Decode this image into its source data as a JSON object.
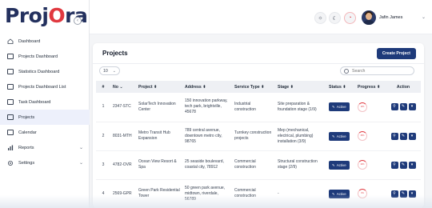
{
  "brand": {
    "logo_part1": "Proj",
    "logo_part2": "O",
    "logo_part3": "ra"
  },
  "sidebar": {
    "items": [
      {
        "label": "Dashboard",
        "icon": "home-icon"
      },
      {
        "label": "Projects Dashboard",
        "icon": "folder-icon"
      },
      {
        "label": "Statistics Dashboard",
        "icon": "chart-icon"
      },
      {
        "label": "Projects Dashboard List",
        "icon": "list-icon"
      },
      {
        "label": "Task Dashboard",
        "icon": "task-icon"
      },
      {
        "label": "Projects",
        "icon": "projects-icon",
        "active": true
      },
      {
        "label": "Calendar",
        "icon": "calendar-icon"
      },
      {
        "label": "Reports",
        "icon": "bar-chart-icon",
        "has_submenu": true
      },
      {
        "label": "Settings",
        "icon": "gear-icon",
        "has_submenu": true
      }
    ]
  },
  "topbar": {
    "collapse_icon": "chevron-left-icon",
    "icons": [
      "sun-icon",
      "moon-icon",
      "notification-icon"
    ],
    "user_name": "Jafin James",
    "user_chevron": "⌄"
  },
  "main": {
    "title": "Projects",
    "create_button": "Create Project",
    "page_length": "10",
    "search_placeholder": "Search",
    "columns": [
      "#",
      "No",
      "Project",
      "Address",
      "Service Type",
      "Stage",
      "Status",
      "Progress",
      "Action"
    ],
    "rows": [
      {
        "index": "1",
        "no": "2347-STC",
        "project": "SolarTech Innovation Center",
        "address": "150 innovation parkway, tech park, brightville, 45678",
        "service": "Industrial construction",
        "stage": "Site preparation & foundation stage (1/9)",
        "status": "Active",
        "progress": "11%"
      },
      {
        "index": "2",
        "no": "8031-MTH",
        "project": "Metro Transit Hub Expansion",
        "address": "789 central avenue, downtown metro city, 98765",
        "service": "Turnkey construction projects",
        "stage": "Mep (mechanical, electrical, plumbing) installation (3/9)",
        "status": "Active",
        "progress": "33%"
      },
      {
        "index": "3",
        "no": "4782-OVR",
        "project": "Ocean View Resort & Spa",
        "address": "25 seaside boulevard, coastal city, 78912",
        "service": "Commercial construction",
        "stage": "Structural construction stage (2/9)",
        "status": "Active",
        "progress": "22%"
      },
      {
        "index": "4",
        "no": "2569-GPR",
        "project": "Green Park Residential Tower",
        "address": "50 green park avenue, midtown, riverdale, 56789",
        "service": "Commercial construction",
        "stage": "-",
        "status": "Active",
        "progress": "0%"
      }
    ]
  },
  "colors": {
    "primary": "#1e3a7a",
    "accent": "#e0383f",
    "logo": "#23305e"
  }
}
